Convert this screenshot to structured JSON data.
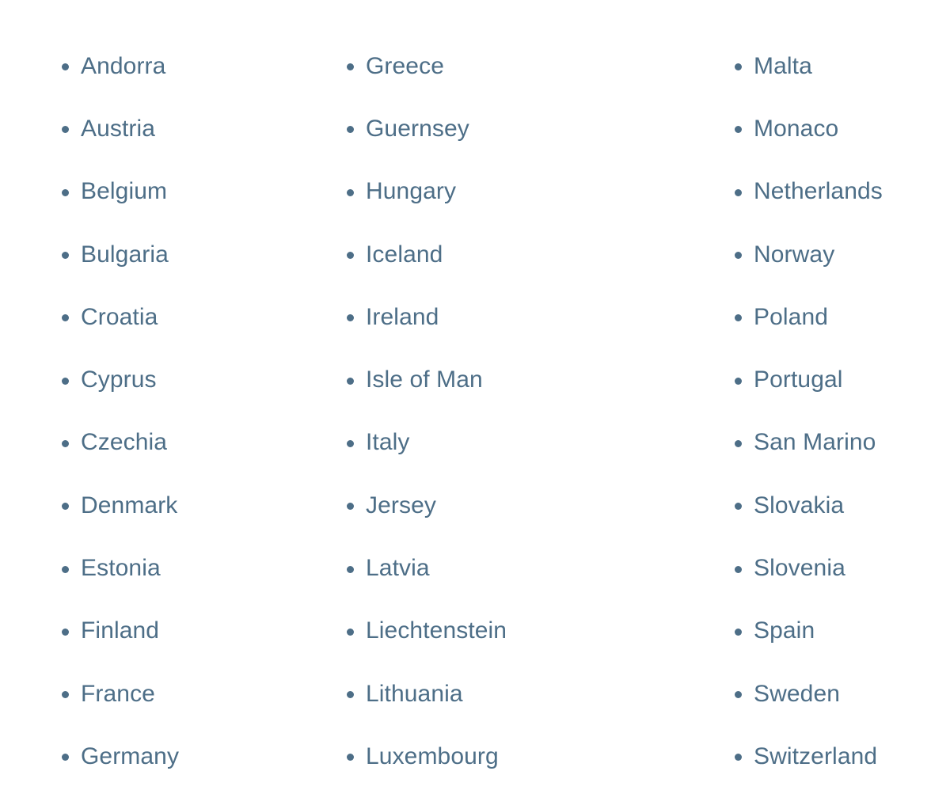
{
  "page": {
    "background_color": "#ffffff",
    "text_color": "#4d6e87",
    "bullet_color": "#4d6e87",
    "layout": "three-column-bulleted-list",
    "total_items": 36
  },
  "list": {
    "bullet_icon": "bullet-dot-icon",
    "columns": [
      {
        "index": 0,
        "items": [
          {
            "label": "Andorra"
          },
          {
            "label": "Austria"
          },
          {
            "label": "Belgium"
          },
          {
            "label": "Bulgaria"
          },
          {
            "label": "Croatia"
          },
          {
            "label": "Cyprus"
          },
          {
            "label": "Czechia"
          },
          {
            "label": "Denmark"
          },
          {
            "label": "Estonia"
          },
          {
            "label": "Finland"
          },
          {
            "label": "France"
          },
          {
            "label": "Germany"
          }
        ]
      },
      {
        "index": 1,
        "items": [
          {
            "label": "Greece"
          },
          {
            "label": "Guernsey"
          },
          {
            "label": "Hungary"
          },
          {
            "label": "Iceland"
          },
          {
            "label": "Ireland"
          },
          {
            "label": "Isle of Man"
          },
          {
            "label": "Italy"
          },
          {
            "label": "Jersey"
          },
          {
            "label": "Latvia"
          },
          {
            "label": "Liechtenstein"
          },
          {
            "label": "Lithuania"
          },
          {
            "label": "Luxembourg"
          }
        ]
      },
      {
        "index": 2,
        "items": [
          {
            "label": "Malta"
          },
          {
            "label": "Monaco"
          },
          {
            "label": "Netherlands"
          },
          {
            "label": "Norway"
          },
          {
            "label": "Poland"
          },
          {
            "label": "Portugal"
          },
          {
            "label": "San Marino"
          },
          {
            "label": "Slovakia"
          },
          {
            "label": "Slovenia"
          },
          {
            "label": "Spain"
          },
          {
            "label": "Sweden"
          },
          {
            "label": "Switzerland"
          }
        ]
      }
    ]
  }
}
